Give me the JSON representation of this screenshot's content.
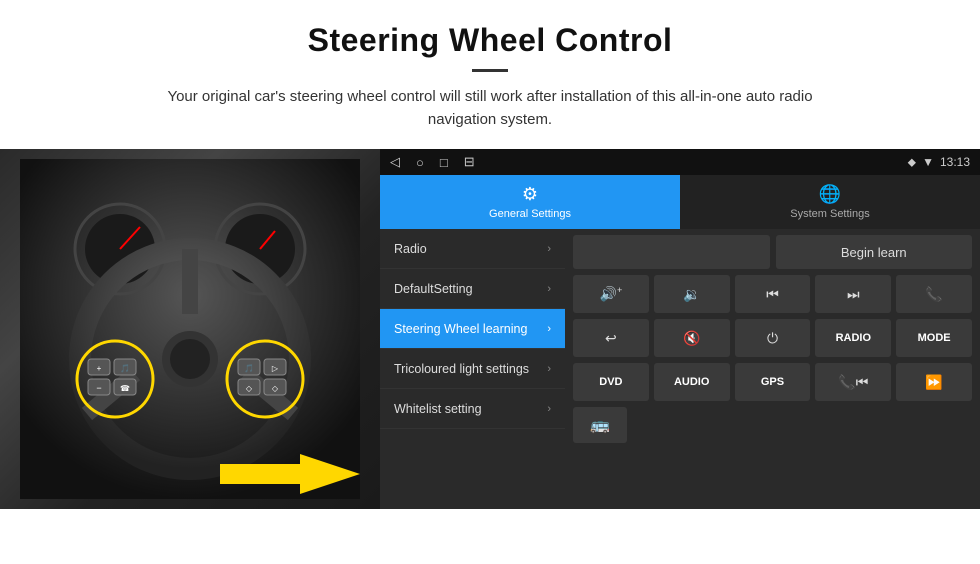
{
  "header": {
    "title": "Steering Wheel Control",
    "description": "Your original car's steering wheel control will still work after installation of this all-in-one auto radio navigation system."
  },
  "status_bar": {
    "time": "13:13",
    "nav_buttons": [
      "◁",
      "○",
      "□",
      "⊟"
    ]
  },
  "tabs": [
    {
      "label": "General Settings",
      "active": true,
      "icon": "⚙"
    },
    {
      "label": "System Settings",
      "active": false,
      "icon": "🌐"
    }
  ],
  "menu_items": [
    {
      "label": "Radio",
      "active": false
    },
    {
      "label": "DefaultSetting",
      "active": false
    },
    {
      "label": "Steering Wheel learning",
      "active": true
    },
    {
      "label": "Tricoloured light settings",
      "active": false
    },
    {
      "label": "Whitelist setting",
      "active": false
    }
  ],
  "radio_row": {
    "blank": "",
    "begin_learn": "Begin learn"
  },
  "controls_row1": [
    {
      "label": "🔊+",
      "type": "icon"
    },
    {
      "label": "🔊-",
      "type": "icon"
    },
    {
      "label": "⏮",
      "type": "icon"
    },
    {
      "label": "⏭",
      "type": "icon"
    },
    {
      "label": "📞",
      "type": "icon"
    }
  ],
  "controls_row2": [
    {
      "label": "↩",
      "type": "icon"
    },
    {
      "label": "🔇",
      "type": "icon"
    },
    {
      "label": "⏻",
      "type": "icon"
    },
    {
      "label": "RADIO",
      "type": "text"
    },
    {
      "label": "MODE",
      "type": "text"
    }
  ],
  "controls_row3": [
    {
      "label": "DVD",
      "type": "text"
    },
    {
      "label": "AUDIO",
      "type": "text"
    },
    {
      "label": "GPS",
      "type": "text"
    },
    {
      "label": "📞⏮",
      "type": "icon"
    },
    {
      "label": "⏪⏭",
      "type": "icon"
    }
  ],
  "bottom_row": [
    {
      "label": "🚌",
      "type": "icon"
    }
  ]
}
